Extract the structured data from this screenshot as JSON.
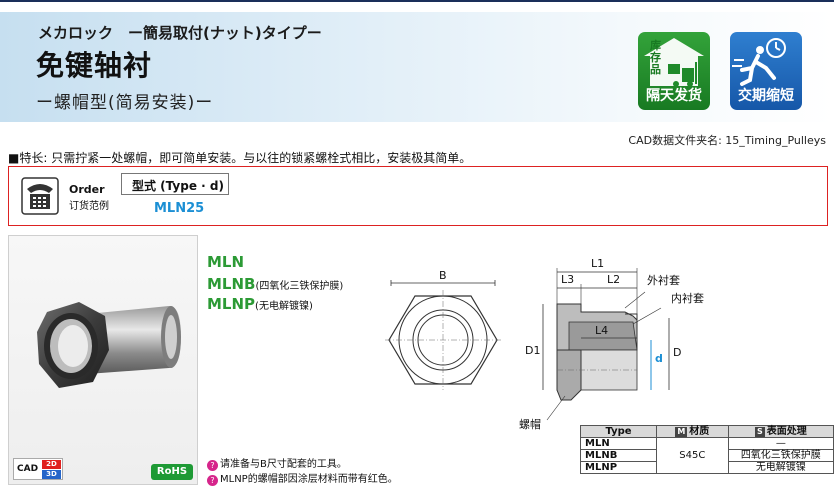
{
  "header": {
    "sub_title": "メカロック　ー簡易取付(ナット)タイプー",
    "main_title": "免键轴衬",
    "type_title": "ー螺帽型(简易安装)ー"
  },
  "badges": {
    "stock_text": "库存品",
    "stock_label": "隔天发货",
    "fast_label": "交期缩短"
  },
  "cad_folder": "CAD数据文件夹名: 15_Timing_Pulleys",
  "feature": "■特长: 只需拧紧一处螺帽，即可简单安装。与以往的锁紧螺栓式相比，安装极其简单。",
  "order": {
    "en": "Order",
    "zh": "订货范例",
    "model_label": "型式 (Type · d)",
    "model_code": "MLN25"
  },
  "photo": {
    "cad_text": "CAD",
    "cad_2d": "2D",
    "cad_3d": "3D",
    "rohs": "RoHS"
  },
  "variants": [
    {
      "code": "MLN",
      "note": ""
    },
    {
      "code": "MLNB",
      "note": "(四氧化三铁保护膜)"
    },
    {
      "code": "MLNP",
      "note": "(无电解镀镍)"
    }
  ],
  "drawing": {
    "B": "B",
    "L1": "L1",
    "L2": "L2",
    "L3": "L3",
    "L4": "L4",
    "D1": "D1",
    "d": "d",
    "D": "D",
    "outer": "外衬套",
    "inner": "内衬套",
    "nut": "螺帽"
  },
  "notes": [
    "请准备与B尺寸配套的工具。",
    "MLNP的螺帽部因涂层材料而带有红色。"
  ],
  "spec_table": {
    "headers": [
      "Type",
      "材质",
      "表面处理"
    ],
    "tag_m": "M",
    "tag_s": "S",
    "rows": [
      {
        "type": "MLN",
        "material": "",
        "surface": "—"
      },
      {
        "type": "MLNB",
        "material": "S45C",
        "surface": "四氧化三铁保护膜"
      },
      {
        "type": "MLNP",
        "material": "",
        "surface": "无电解镀镍"
      }
    ]
  },
  "colors": {
    "accent_blue": "#1c8fd4",
    "variant_green": "#2c9a35",
    "order_border": "#dd2222",
    "header_navy": "#1a2f5a"
  }
}
